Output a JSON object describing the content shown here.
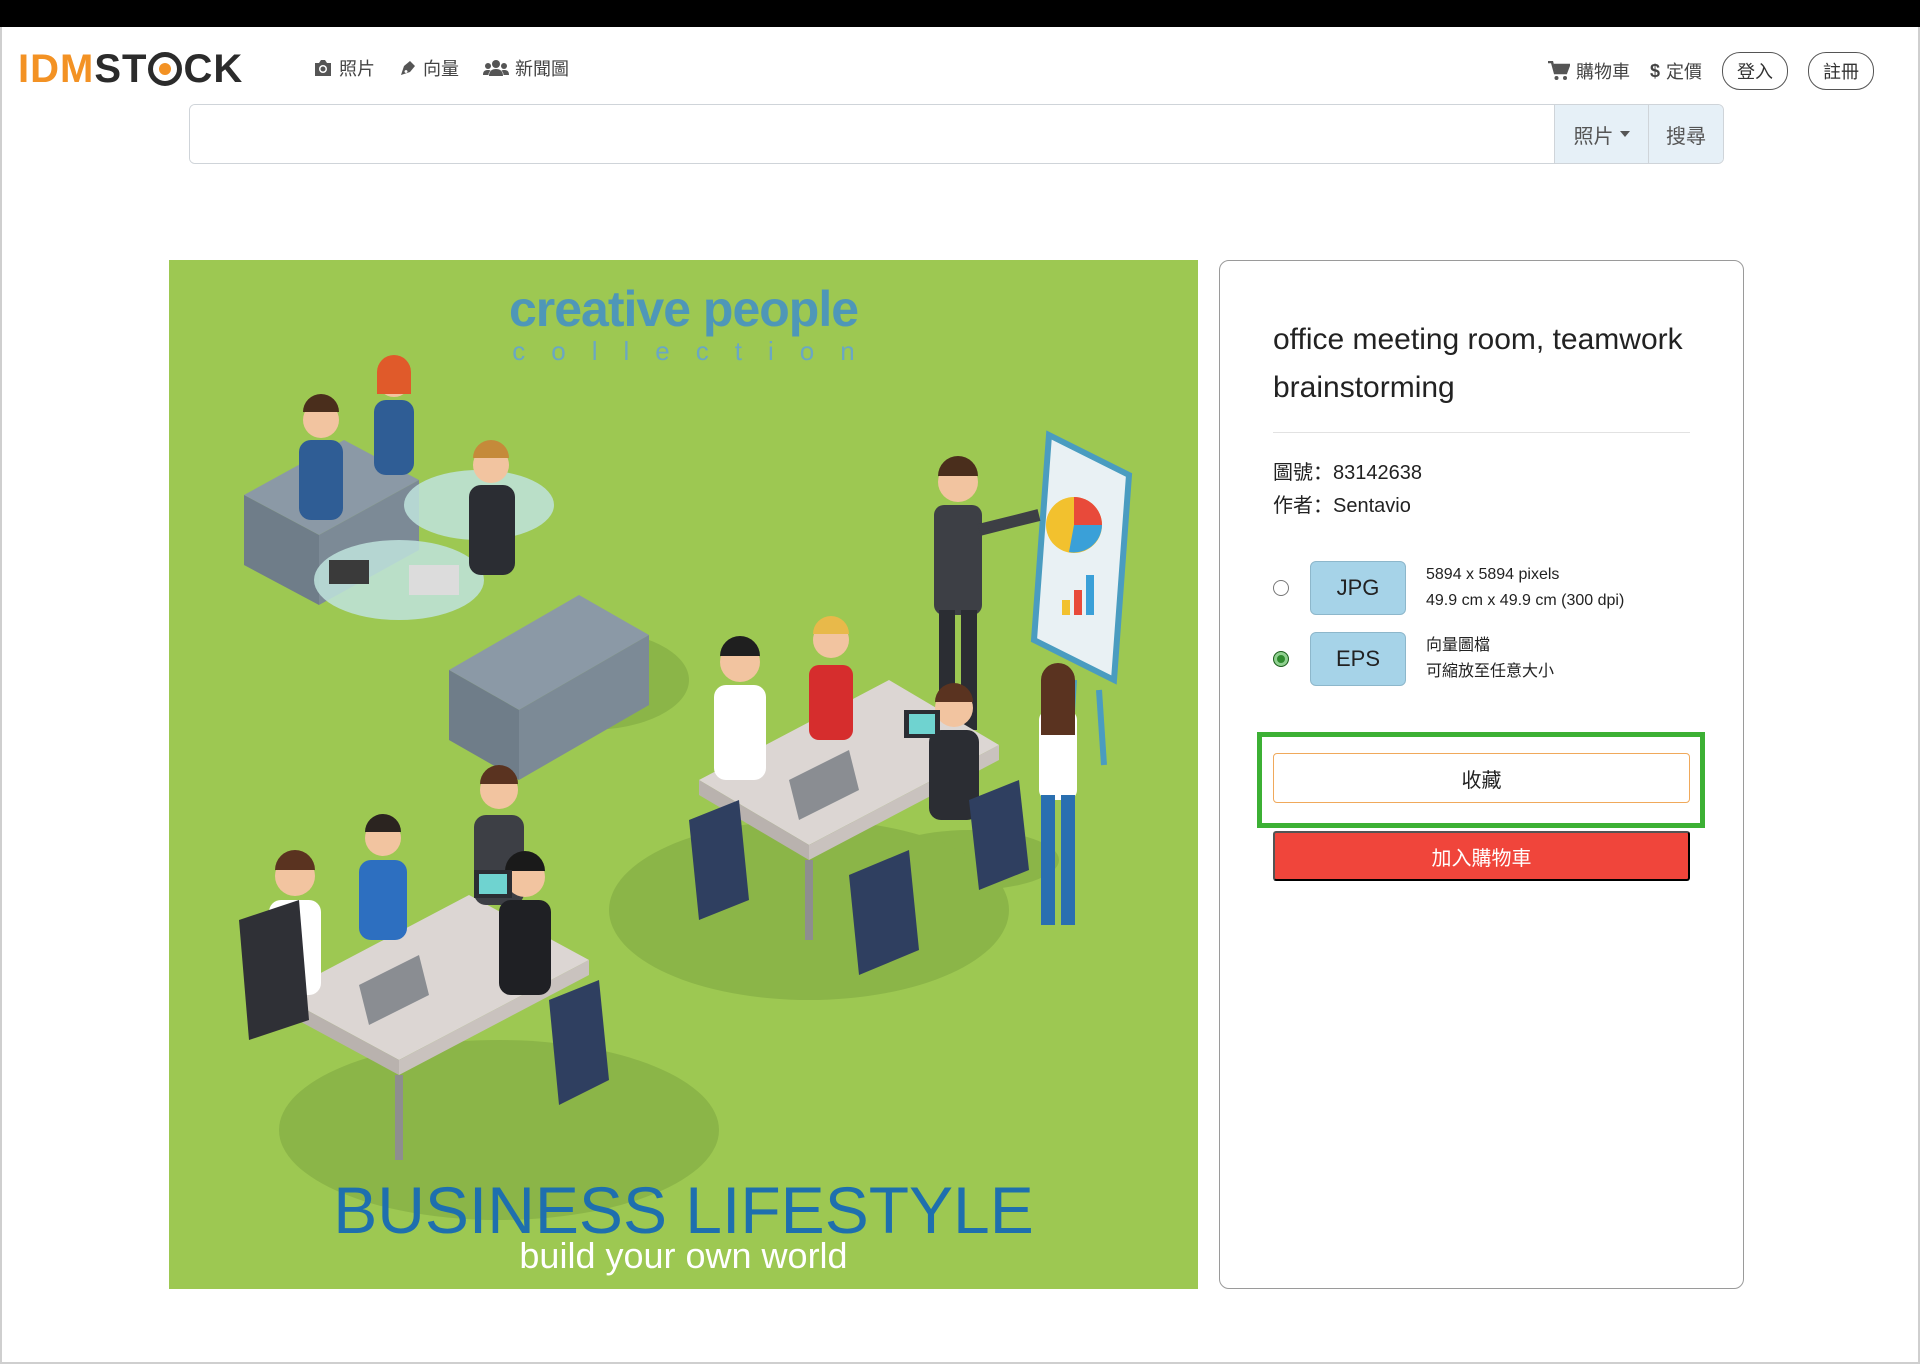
{
  "logo": {
    "part1": "IDM",
    "part2": "ST",
    "part3": "CK"
  },
  "nav": {
    "left": [
      {
        "label": "照片",
        "icon": "camera-icon"
      },
      {
        "label": "向量",
        "icon": "pen-icon"
      },
      {
        "label": "新聞圖",
        "icon": "users-icon"
      }
    ],
    "cart_label": "購物車",
    "pricing_label": "定價",
    "pricing_symbol": "$",
    "login_label": "登入",
    "register_label": "註冊"
  },
  "search": {
    "value": "",
    "placeholder": "",
    "type_selected": "照片",
    "submit_label": "搜尋"
  },
  "image": {
    "brand_line1": "creative people",
    "brand_line2": "collection",
    "headline": "BUSINESS LIFESTYLE",
    "tagline": "build your own world"
  },
  "detail": {
    "title": "office meeting room, teamwork brainstorming",
    "id_label": "圖號：",
    "id_value": "83142638",
    "author_label": "作者：",
    "author_value": "Sentavio",
    "options": [
      {
        "format": "JPG",
        "line1": "5894 x 5894 pixels",
        "line2": "49.9 cm x 49.9 cm (300 dpi)",
        "selected": false
      },
      {
        "format": "EPS",
        "line1": "向量圖檔",
        "line2": "可縮放至任意大小",
        "selected": true
      }
    ],
    "favorite_label": "收藏",
    "add_to_cart_label": "加入購物車"
  },
  "colors": {
    "accent_orange": "#f39224",
    "image_bg": "#9dc852",
    "format_btn": "#a6d3e8",
    "cart_btn": "#f0453b",
    "highlight_green": "#3cb034"
  }
}
